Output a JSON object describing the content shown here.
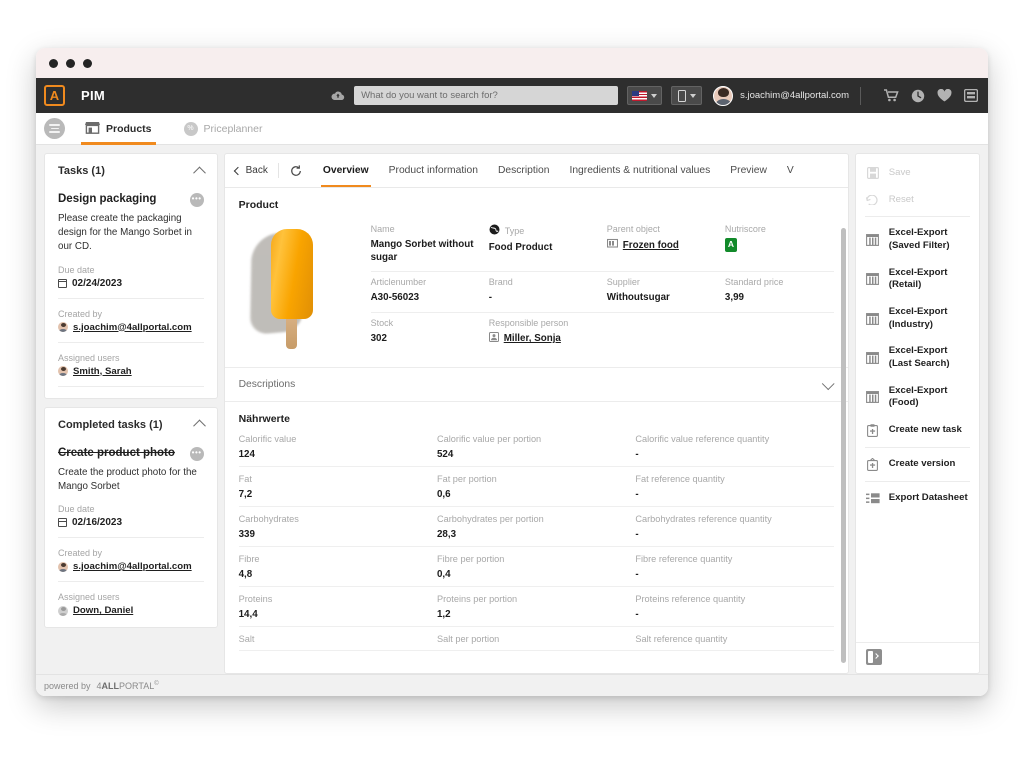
{
  "window": {
    "dots": 3
  },
  "topbar": {
    "logo_letter": "A",
    "brand": "PIM",
    "cloud_icon": "cloud-upload-icon",
    "search_placeholder": "What do you want to search for?",
    "search_value": "",
    "language": "en-US",
    "device": "mobile",
    "user_email": "s.joachim@4allportal.com",
    "icons": [
      "cart-icon",
      "clock-icon",
      "heart-icon",
      "panel-icon"
    ]
  },
  "modulebar": {
    "menu_icon": "hamburger-menu-icon",
    "tabs": [
      {
        "label": "Products",
        "icon": "storefront-icon",
        "active": true
      },
      {
        "label": "Priceplanner",
        "icon": "percent-badge-icon",
        "active": false
      }
    ]
  },
  "tasks_panel": {
    "title": "Tasks (1)",
    "collapse_icon": "chevron-up-icon",
    "task": {
      "title": "Design packaging",
      "description": "Please create the packaging design for the Mango Sorbet in our CD.",
      "due_label": "Due date",
      "due_date": "02/24/2023",
      "created_label": "Created by",
      "created_by": "s.joachim@4allportal.com",
      "assigned_label": "Assigned users",
      "assigned_user": "Smith, Sarah",
      "menu_icon": "ellipsis-icon"
    }
  },
  "completed_panel": {
    "title": "Completed tasks (1)",
    "collapse_icon": "chevron-up-icon",
    "task": {
      "title": "Create product photo",
      "description": "Create the product photo for the Mango Sorbet",
      "due_label": "Due date",
      "due_date": "02/16/2023",
      "created_label": "Created by",
      "created_by": "s.joachim@4allportal.com",
      "assigned_label": "Assigned users",
      "assigned_user": "Down, Daniel",
      "menu_icon": "ellipsis-icon"
    }
  },
  "content": {
    "back_label": "Back",
    "refresh_icon": "refresh-icon",
    "tabs": [
      {
        "label": "Overview",
        "active": true
      },
      {
        "label": "Product information",
        "active": false
      },
      {
        "label": "Description",
        "active": false
      },
      {
        "label": "Ingredients & nutritional values",
        "active": false
      },
      {
        "label": "Preview",
        "active": false
      },
      {
        "label": "V",
        "active": false
      }
    ],
    "product_section_title": "Product",
    "product_image": "mango-popsicle-photo",
    "fields": [
      {
        "label": "Name",
        "value": "Mango Sorbet without sugar",
        "icon": ""
      },
      {
        "label": "Type",
        "value": "Food Product",
        "icon": "globe-icon"
      },
      {
        "label": "Parent object",
        "value": "Frozen food",
        "icon": "folder-icon",
        "link": true
      },
      {
        "label": "Nutriscore",
        "value": "A",
        "icon": "",
        "badge": true
      },
      {
        "label": "Articlenumber",
        "value": "A30-56023",
        "icon": ""
      },
      {
        "label": "Brand",
        "value": "-",
        "icon": ""
      },
      {
        "label": "Supplier",
        "value": "Withoutsugar",
        "icon": ""
      },
      {
        "label": "Standard price",
        "value": "3,99",
        "icon": ""
      },
      {
        "label": "Stock",
        "value": "302",
        "icon": ""
      },
      {
        "label": "Responsible person",
        "value": "Miller, Sonja",
        "icon": "user-icon",
        "link": true
      }
    ],
    "descriptions_label": "Descriptions",
    "descriptions_icon": "chevron-down-icon",
    "nutrition_title": "Nährwerte",
    "nutrition_rows": [
      {
        "label": "Calorific value",
        "value": "124",
        "portion_label": "Calorific value per portion",
        "portion_value": "524",
        "ref_label": "Calorific value reference quantity",
        "ref_value": "-"
      },
      {
        "label": "Fat",
        "value": "7,2",
        "portion_label": "Fat per portion",
        "portion_value": "0,6",
        "ref_label": "Fat reference quantity",
        "ref_value": "-"
      },
      {
        "label": "Carbohydrates",
        "value": "339",
        "portion_label": "Carbohydrates per portion",
        "portion_value": "28,3",
        "ref_label": "Carbohydrates reference quantity",
        "ref_value": "-"
      },
      {
        "label": "Fibre",
        "value": "4,8",
        "portion_label": "Fibre per portion",
        "portion_value": "0,4",
        "ref_label": "Fibre reference quantity",
        "ref_value": "-"
      },
      {
        "label": "Proteins",
        "value": "14,4",
        "portion_label": "Proteins per portion",
        "portion_value": "1,2",
        "ref_label": "Proteins reference quantity",
        "ref_value": "-"
      },
      {
        "label": "Salt",
        "value": "",
        "portion_label": "Salt per portion",
        "portion_value": "",
        "ref_label": "Salt reference quantity",
        "ref_value": ""
      }
    ]
  },
  "actions": {
    "items": [
      {
        "label": "Save",
        "icon": "save-icon",
        "disabled": true
      },
      {
        "label": "Reset",
        "icon": "reset-icon",
        "disabled": true
      },
      {
        "label": "Excel-Export (Saved Filter)",
        "icon": "table-icon",
        "disabled": false
      },
      {
        "label": "Excel-Export (Retail)",
        "icon": "table-icon",
        "disabled": false
      },
      {
        "label": "Excel-Export (Industry)",
        "icon": "table-icon",
        "disabled": false
      },
      {
        "label": "Excel-Export (Last Search)",
        "icon": "table-icon",
        "disabled": false
      },
      {
        "label": "Excel-Export (Food)",
        "icon": "table-icon",
        "disabled": false
      },
      {
        "label": "Create new task",
        "icon": "clipboard-plus-icon",
        "disabled": false
      },
      {
        "label": "Create version",
        "icon": "version-icon",
        "disabled": false
      },
      {
        "label": "Export Datasheet",
        "icon": "datasheet-icon",
        "disabled": false
      }
    ],
    "collapse_icon": "panel-collapse-icon"
  },
  "footer": {
    "prefix": "powered by",
    "brand_pre": "4",
    "brand_bold": "ALL",
    "brand_post": "PORTAL",
    "copyright": "©"
  },
  "colors": {
    "accent": "#f08a1e",
    "topbar_bg": "#2e2e2e",
    "nutriscore_green": "#128a2a",
    "page_bg": "#f1f1f1"
  }
}
